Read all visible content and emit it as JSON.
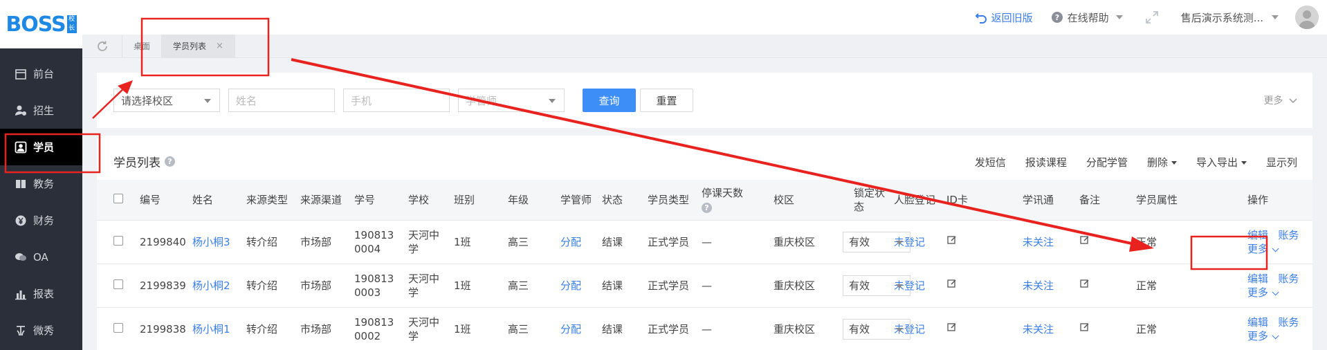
{
  "sidebar": {
    "logo_text": "BOSS",
    "logo_badge": "校长",
    "items": [
      {
        "label": "前台",
        "icon": "calendar-icon"
      },
      {
        "label": "招生",
        "icon": "user-add-icon"
      },
      {
        "label": "学员",
        "icon": "student-icon"
      },
      {
        "label": "教务",
        "icon": "book-icon"
      },
      {
        "label": "财务",
        "icon": "yen-icon"
      },
      {
        "label": "OA",
        "icon": "chat-icon"
      },
      {
        "label": "报表",
        "icon": "bar-chart-icon"
      },
      {
        "label": "微秀",
        "icon": "xiu-icon"
      }
    ]
  },
  "topbar": {
    "back_label": "返回旧版",
    "help_label": "在线帮助",
    "user_label": "售后演示系统测..."
  },
  "tabs": {
    "desk": "桌面",
    "students": "学员列表",
    "close": "×"
  },
  "filter": {
    "campus_placeholder": "请选择校区",
    "name_placeholder": "姓名",
    "phone_placeholder": "手机",
    "manager_placeholder": "学管师",
    "search_label": "查询",
    "reset_label": "重置",
    "more_label": "更多"
  },
  "list": {
    "title": "学员列表",
    "actions": {
      "sms": "发短信",
      "enroll": "报读课程",
      "assign": "分配学管",
      "delete": "删除",
      "import_export": "导入导出",
      "columns": "显示列"
    },
    "columns": [
      "编号",
      "姓名",
      "来源类型",
      "来源渠道",
      "学号",
      "学校",
      "班别",
      "年级",
      "学管师",
      "状态",
      "学员类型",
      "停课天数",
      "校区",
      "锁定状态",
      "人脸登记",
      "ID卡",
      "学讯通",
      "备注",
      "学员属性",
      "操作"
    ],
    "rows": [
      {
        "id": "2199840",
        "name": "杨小桐3",
        "source_type": "转介绍",
        "channel": "市场部",
        "student_no": "1908130004",
        "school": "天河中学",
        "class": "1班",
        "grade": "高三",
        "manager": "分配",
        "status": "结课",
        "type": "正式学员",
        "stop_days": "—",
        "campus": "重庆校区",
        "lock": "有效",
        "face": "未登记",
        "follow": "未关注",
        "attr": "正常",
        "edit": "编辑",
        "account": "账务",
        "more": "更多"
      },
      {
        "id": "2199839",
        "name": "杨小桐2",
        "source_type": "转介绍",
        "channel": "市场部",
        "student_no": "1908130003",
        "school": "天河中学",
        "class": "1班",
        "grade": "高三",
        "manager": "分配",
        "status": "结课",
        "type": "正式学员",
        "stop_days": "—",
        "campus": "重庆校区",
        "lock": "有效",
        "face": "未登记",
        "follow": "未关注",
        "attr": "正常",
        "edit": "编辑",
        "account": "账务",
        "more": "更多"
      },
      {
        "id": "2199838",
        "name": "杨小桐1",
        "source_type": "转介绍",
        "channel": "市场部",
        "student_no": "1908130002",
        "school": "天河中学",
        "class": "1班",
        "grade": "高三",
        "manager": "分配",
        "status": "结课",
        "type": "正式学员",
        "stop_days": "—",
        "campus": "重庆校区",
        "lock": "有效",
        "face": "未登记",
        "follow": "未关注",
        "attr": "正常",
        "edit": "编辑",
        "account": "账务",
        "more": "更多"
      }
    ]
  },
  "colors": {
    "sidebar_bg": "#2b2f3a",
    "accent": "#3a7ee8",
    "annotation": "#e8231f"
  }
}
